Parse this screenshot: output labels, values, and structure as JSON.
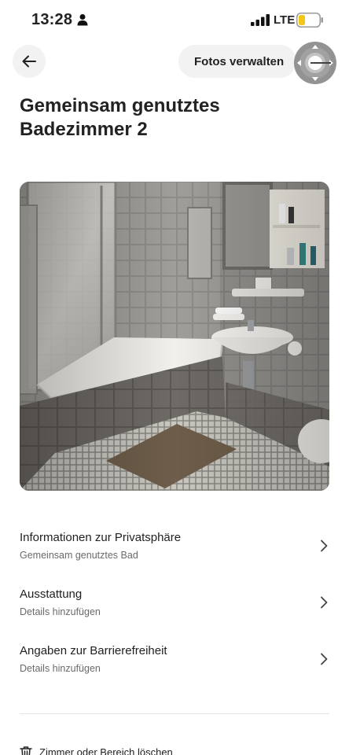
{
  "status_bar": {
    "time": "13:28",
    "network": "LTE",
    "battery_color": "#f5c518"
  },
  "header": {
    "back_icon": "arrow-left-icon",
    "manage_photos_label": "Fotos verwalten"
  },
  "page": {
    "title": "Gemeinsam genutztes Badezimmer 2"
  },
  "photo": {
    "subject": "bathroom-photo"
  },
  "sections": [
    {
      "title": "Informationen zur Privatsphäre",
      "subtitle": "Gemeinsam genutztes Bad"
    },
    {
      "title": "Ausstattung",
      "subtitle": "Details hinzufügen"
    },
    {
      "title": "Angaben zur Barrierefreiheit",
      "subtitle": "Details hinzufügen"
    }
  ],
  "footer": {
    "delete_label": "Zimmer oder Bereich löschen"
  }
}
